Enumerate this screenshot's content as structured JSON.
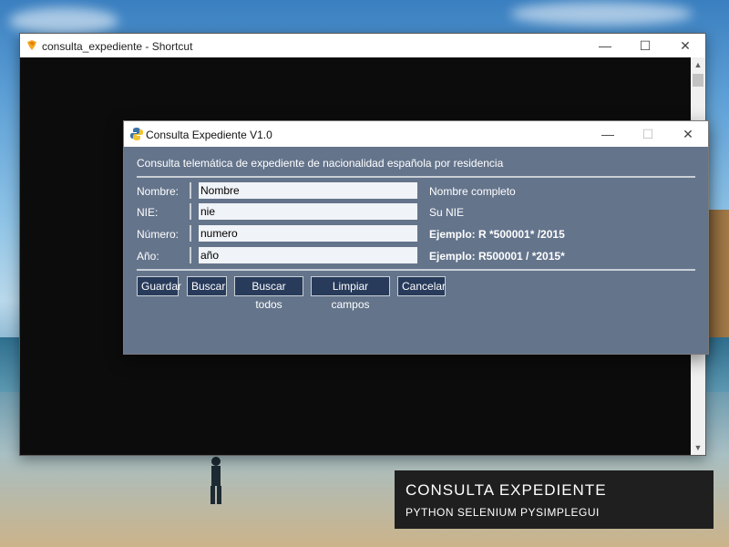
{
  "console": {
    "title": "consulta_expediente - Shortcut",
    "minimize": "—",
    "maximize": "☐",
    "close": "✕"
  },
  "dialog": {
    "title": "Consulta Expediente V1.0",
    "minimize": "—",
    "maximize": "☐",
    "close": "✕",
    "subtitle": "Consulta telemática de expediente de nacionalidad española por residencia",
    "fields": [
      {
        "label": "Nombre:",
        "value": "Nombre",
        "hint": "Nombre completo"
      },
      {
        "label": "NIE:",
        "value": "nie",
        "hint": "Su NIE"
      },
      {
        "label": "Número:",
        "value": "numero",
        "hint": "Ejemplo: R *500001* /2015"
      },
      {
        "label": "Año:",
        "value": "año",
        "hint": "Ejemplo: R500001 / *2015*"
      }
    ],
    "buttons": {
      "guardar": "Guardar",
      "buscar": "Buscar",
      "buscar_todos": "Buscar todos",
      "limpiar": "Limpiar campos",
      "cancelar": "Cancelar"
    }
  },
  "caption": {
    "line1": "CONSULTA EXPEDIENTE",
    "line2": "PYTHON  SELENIUM PYSIMPLEGUI"
  },
  "colors": {
    "dialog_bg": "#64748b",
    "button_bg": "#283b5b",
    "console_bg": "#0c0c0c"
  }
}
